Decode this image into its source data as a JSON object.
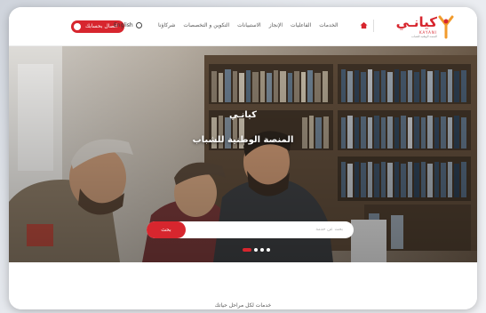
{
  "header": {
    "login_label": "اتصال بحسابك",
    "language_label": "English",
    "nav_items": [
      "الخدمات",
      "الفاعليات",
      "الإنجاز",
      "الاستبيانات",
      "التكوين و التخصصات",
      "شركاؤنا"
    ],
    "logo_text": "كيانـي",
    "logo_sub": "KAYANI",
    "logo_tagline": "المنصة الوطنية للشباب"
  },
  "hero": {
    "brand": "كيانـي",
    "subtitle": "المنصة الوطنية للشباب",
    "search_placeholder": "بحث عن خدمة",
    "search_button": "بحث",
    "slide_count": 4,
    "active_slide": 1
  },
  "section": {
    "title_partial": "خدمات لكل مراحل حياتك"
  },
  "colors": {
    "accent": "#d7262e",
    "logo_orange": "#f19a2b"
  }
}
